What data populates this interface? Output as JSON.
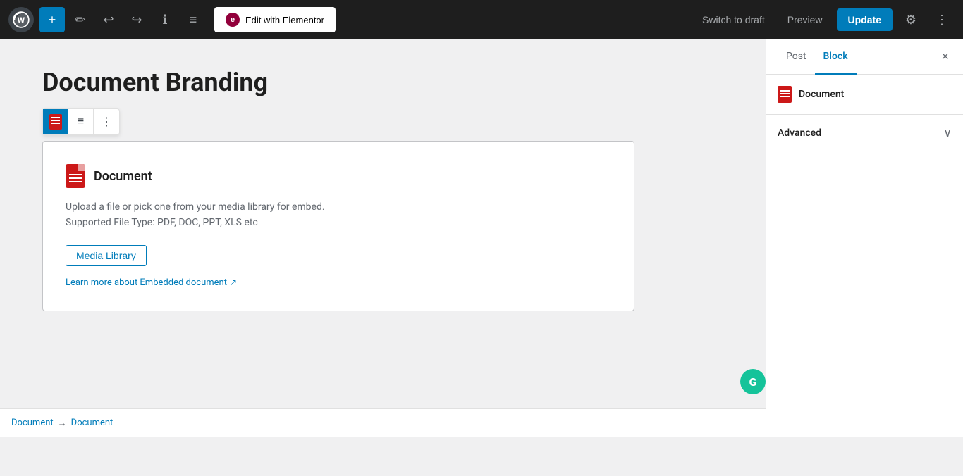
{
  "toolbar": {
    "add_label": "+",
    "elementor_label": "Edit with Elementor",
    "elementor_icon": "e",
    "switch_draft_label": "Switch to draft",
    "preview_label": "Preview",
    "update_label": "Update",
    "undo_icon": "↩",
    "redo_icon": "↪",
    "info_icon": "ℹ",
    "list_icon": "≡",
    "gear_icon": "⚙",
    "more_icon": "⋮"
  },
  "post": {
    "title": "Document Branding"
  },
  "block_toolbar": {
    "doc_icon_title": "Document icon",
    "align_icon": "≡",
    "more_icon": "⋮"
  },
  "document_block": {
    "icon_title": "Document icon",
    "heading": "Document",
    "description_line1": "Upload a file or pick one from your media library for embed.",
    "description_line2": "Supported File Type: PDF, DOC, PPT, XLS etc",
    "media_library_btn": "Media Library",
    "learn_more_text": "Learn more about Embedded document",
    "external_icon": "↗"
  },
  "sidebar": {
    "post_tab": "Post",
    "block_tab": "Block",
    "close_icon": "×",
    "block_name": "Document",
    "advanced_label": "Advanced",
    "chevron_icon": "∨"
  },
  "breadcrumb": {
    "item1": "Document",
    "separator": "→",
    "item2": "Document"
  },
  "grammarly": {
    "icon": "G"
  },
  "colors": {
    "toolbar_bg": "#1e1e1e",
    "accent_blue": "#007cba",
    "doc_red": "#cc1818",
    "grammarly_green": "#15c39a"
  }
}
